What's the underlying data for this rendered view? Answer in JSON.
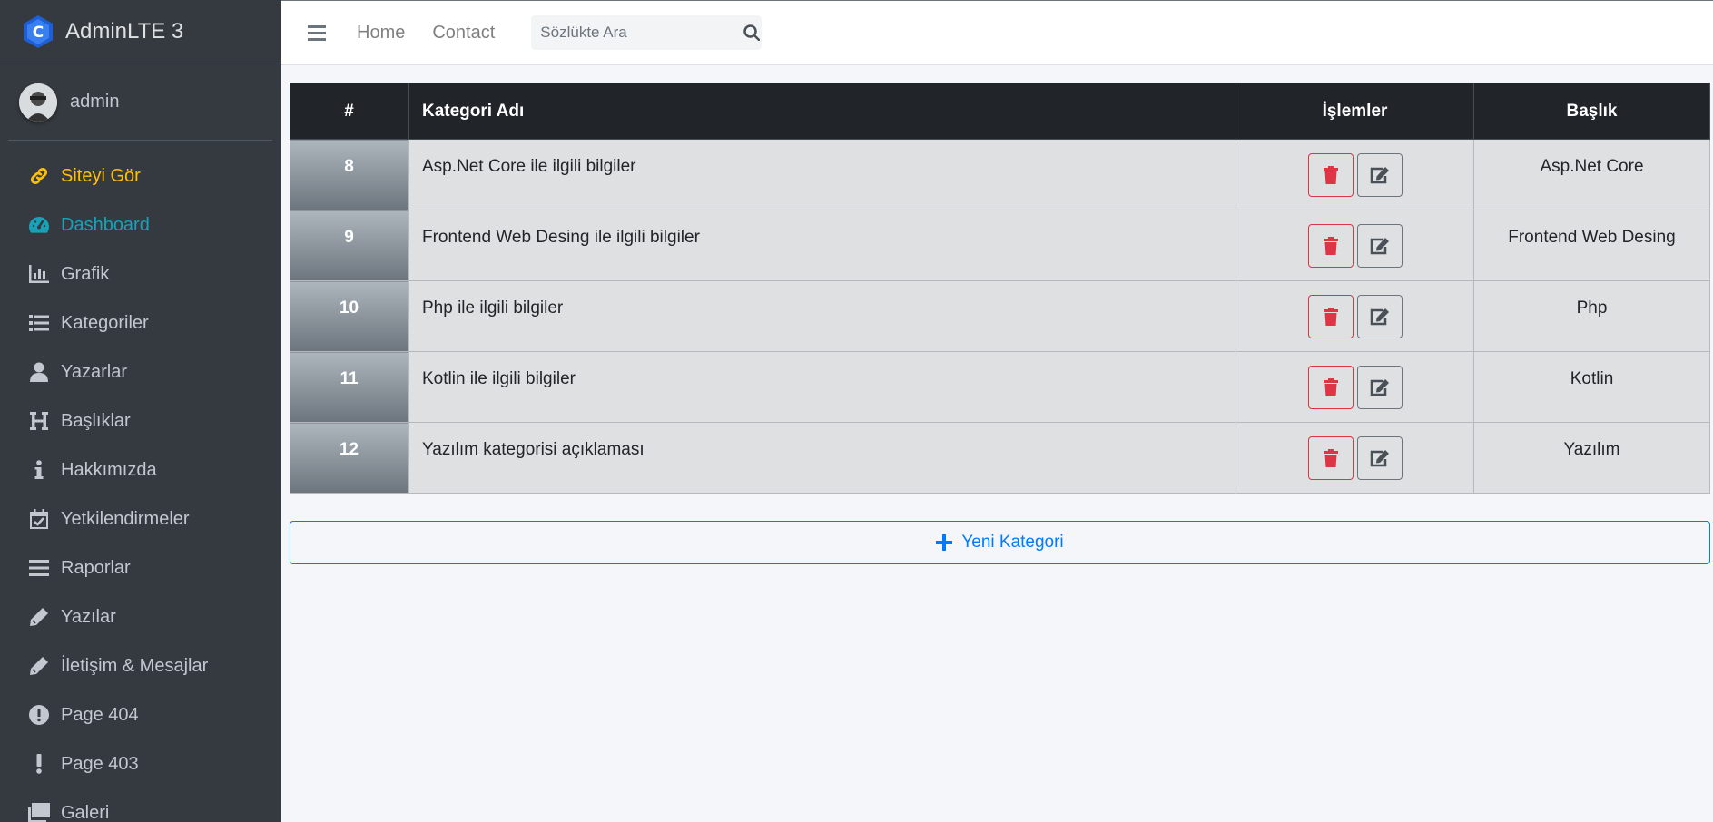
{
  "brand": {
    "title": "AdminLTE 3"
  },
  "user": {
    "name": "admin"
  },
  "sidebar": {
    "items": [
      {
        "label": "Siteyi Gör",
        "icon": "link-icon",
        "color": "#ffc107"
      },
      {
        "label": "Dashboard",
        "icon": "tachometer-icon",
        "color": "#17a2b8"
      },
      {
        "label": "Grafik",
        "icon": "bar-chart-icon"
      },
      {
        "label": "Kategoriler",
        "icon": "list-icon"
      },
      {
        "label": "Yazarlar",
        "icon": "user-icon"
      },
      {
        "label": "Başlıklar",
        "icon": "heading-icon"
      },
      {
        "label": "Hakkımızda",
        "icon": "info-icon"
      },
      {
        "label": "Yetkilendirmeler",
        "icon": "calendar-check-icon"
      },
      {
        "label": "Raporlar",
        "icon": "bars-icon"
      },
      {
        "label": "Yazılar",
        "icon": "pen-icon"
      },
      {
        "label": "İletişim & Mesajlar",
        "icon": "pen-icon"
      },
      {
        "label": "Page 404",
        "icon": "exclamation-circle-icon"
      },
      {
        "label": "Page 403",
        "icon": "exclamation-icon"
      },
      {
        "label": "Galeri",
        "icon": "images-icon"
      }
    ]
  },
  "navbar": {
    "links": [
      "Home",
      "Contact"
    ],
    "search_placeholder": "Sözlükte Ara"
  },
  "table": {
    "headers": [
      "#",
      "Kategori Adı",
      "İşlemler",
      "Başlık"
    ],
    "rows": [
      {
        "id": "8",
        "name": "Asp.Net Core ile ilgili bilgiler",
        "title": "Asp.Net Core"
      },
      {
        "id": "9",
        "name": "Frontend Web Desing ile ilgili bilgiler",
        "title": "Frontend Web Desing"
      },
      {
        "id": "10",
        "name": "Php ile ilgili bilgiler",
        "title": "Php"
      },
      {
        "id": "11",
        "name": "Kotlin ile ilgili bilgiler",
        "title": "Kotlin"
      },
      {
        "id": "12",
        "name": "Yazılım kategorisi açıklaması",
        "title": "Yazılım"
      }
    ]
  },
  "actions": {
    "new_category": "Yeni Kategori"
  },
  "colors": {
    "accent": "#007bff",
    "danger": "#dc3545",
    "warning": "#ffc107",
    "info": "#17a2b8",
    "sidebar": "#343a40"
  }
}
